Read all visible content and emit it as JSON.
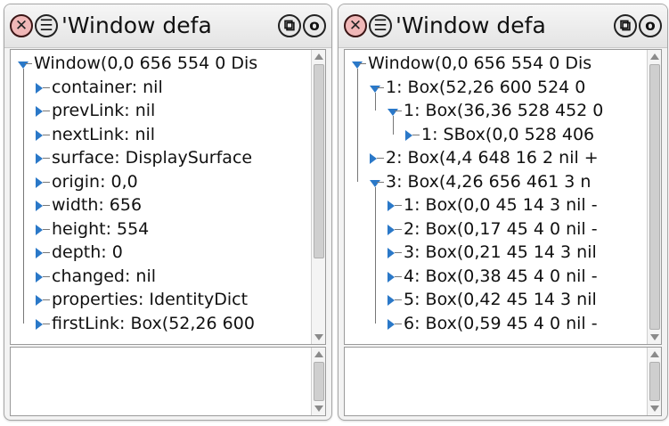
{
  "windows": [
    {
      "title": "'Window defa",
      "buttons": {
        "close_glyph": "✕",
        "menu_glyph": "☰",
        "collapse_glyph": "⧉",
        "expand_glyph": "o"
      },
      "tree": [
        {
          "depth": 0,
          "expanded": true,
          "label": "Window(0,0 656 554 0 Dis"
        },
        {
          "depth": 1,
          "expanded": false,
          "label": "container: nil"
        },
        {
          "depth": 1,
          "expanded": false,
          "label": "prevLink: nil"
        },
        {
          "depth": 1,
          "expanded": false,
          "label": "nextLink: nil"
        },
        {
          "depth": 1,
          "expanded": false,
          "label": "surface: DisplaySurface"
        },
        {
          "depth": 1,
          "expanded": false,
          "label": "origin: 0,0"
        },
        {
          "depth": 1,
          "expanded": false,
          "label": "width: 656"
        },
        {
          "depth": 1,
          "expanded": false,
          "label": "height: 554"
        },
        {
          "depth": 1,
          "expanded": false,
          "label": "depth: 0"
        },
        {
          "depth": 1,
          "expanded": false,
          "label": "changed: nil"
        },
        {
          "depth": 1,
          "expanded": false,
          "label": "properties: IdentityDict"
        },
        {
          "depth": 1,
          "expanded": false,
          "label": "firstLink: Box(52,26 600"
        }
      ],
      "text_pane": ""
    },
    {
      "title": "'Window defa",
      "buttons": {
        "close_glyph": "✕",
        "menu_glyph": "☰",
        "collapse_glyph": "⧉",
        "expand_glyph": "o"
      },
      "tree": [
        {
          "depth": 0,
          "expanded": true,
          "label": "Window(0,0 656 554 0 Dis"
        },
        {
          "depth": 1,
          "expanded": true,
          "label": "1: Box(52,26 600 524 0"
        },
        {
          "depth": 2,
          "expanded": true,
          "label": "1: Box(36,36 528 452 0"
        },
        {
          "depth": 3,
          "expanded": false,
          "label": "1: SBox(0,0 528 406"
        },
        {
          "depth": 1,
          "expanded": false,
          "label": "2: Box(4,4 648 16 2 nil +"
        },
        {
          "depth": 1,
          "expanded": true,
          "label": "3: Box(4,26 656 461 3 n"
        },
        {
          "depth": 2,
          "expanded": false,
          "label": "1: Box(0,0 45 14 3 nil -"
        },
        {
          "depth": 2,
          "expanded": false,
          "label": "2: Box(0,17 45 4 0 nil -"
        },
        {
          "depth": 2,
          "expanded": false,
          "label": "3: Box(0,21 45 14 3 nil"
        },
        {
          "depth": 2,
          "expanded": false,
          "label": "4: Box(0,38 45 4 0 nil -"
        },
        {
          "depth": 2,
          "expanded": false,
          "label": "5: Box(0,42 45 14 3 nil"
        },
        {
          "depth": 2,
          "expanded": false,
          "label": "6: Box(0,59 45 4 0 nil -"
        }
      ],
      "text_pane": ""
    }
  ]
}
